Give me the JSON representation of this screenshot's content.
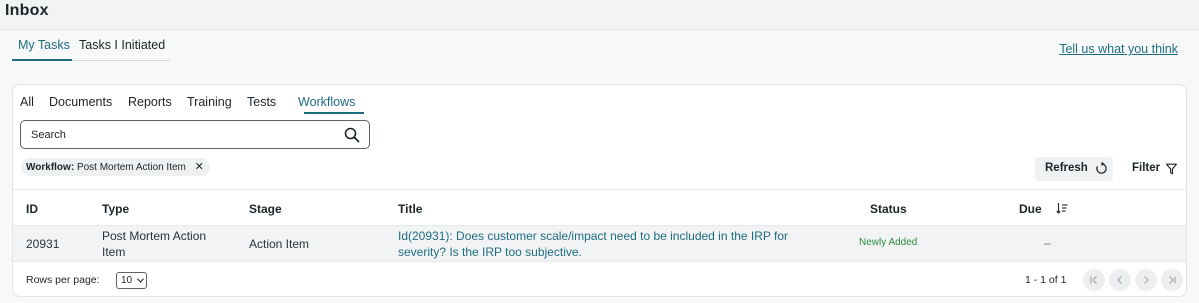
{
  "header": {
    "title": "Inbox"
  },
  "main_tabs": [
    {
      "label": "My Tasks",
      "active": true
    },
    {
      "label": "Tasks I Initiated",
      "active": false
    }
  ],
  "feedback_link": "Tell us what you think",
  "category_tabs": [
    {
      "label": "All",
      "active": false
    },
    {
      "label": "Documents",
      "active": false
    },
    {
      "label": "Reports",
      "active": false
    },
    {
      "label": "Training",
      "active": false
    },
    {
      "label": "Tests",
      "active": false
    },
    {
      "label": "Workflows",
      "active": true
    }
  ],
  "search": {
    "placeholder": "Search",
    "value": "",
    "icon": "search-icon"
  },
  "filter_chip": {
    "key": "Workflow:",
    "value": "Post Mortem Action Item",
    "close_icon": "close-icon"
  },
  "toolbar": {
    "refresh_label": "Refresh",
    "refresh_icon": "refresh-icon",
    "filter_label": "Filter",
    "filter_icon": "funnel-icon"
  },
  "table": {
    "columns": [
      "ID",
      "Type",
      "Stage",
      "Title",
      "Status",
      "Due"
    ],
    "sort_icon": "sort-descending-icon",
    "rows": [
      {
        "id": "20931",
        "type": "Post Mortem Action Item",
        "stage": "Action Item",
        "title": "Id(20931): Does customer scale/impact need to be included in the IRP for severity? Is the IRP too subjective.",
        "status": "Newly Added",
        "due": "–"
      }
    ]
  },
  "pagination": {
    "rows_per_page_label": "Rows per page:",
    "rows_per_page_value": "10",
    "range": "1 - 1 of 1",
    "icons": [
      "first-page-icon",
      "previous-page-icon",
      "next-page-icon",
      "last-page-icon"
    ]
  },
  "colors": {
    "accent": "#1f6d80",
    "status_new": "#2e8b3c",
    "row_bg": "#f2f3f4"
  }
}
